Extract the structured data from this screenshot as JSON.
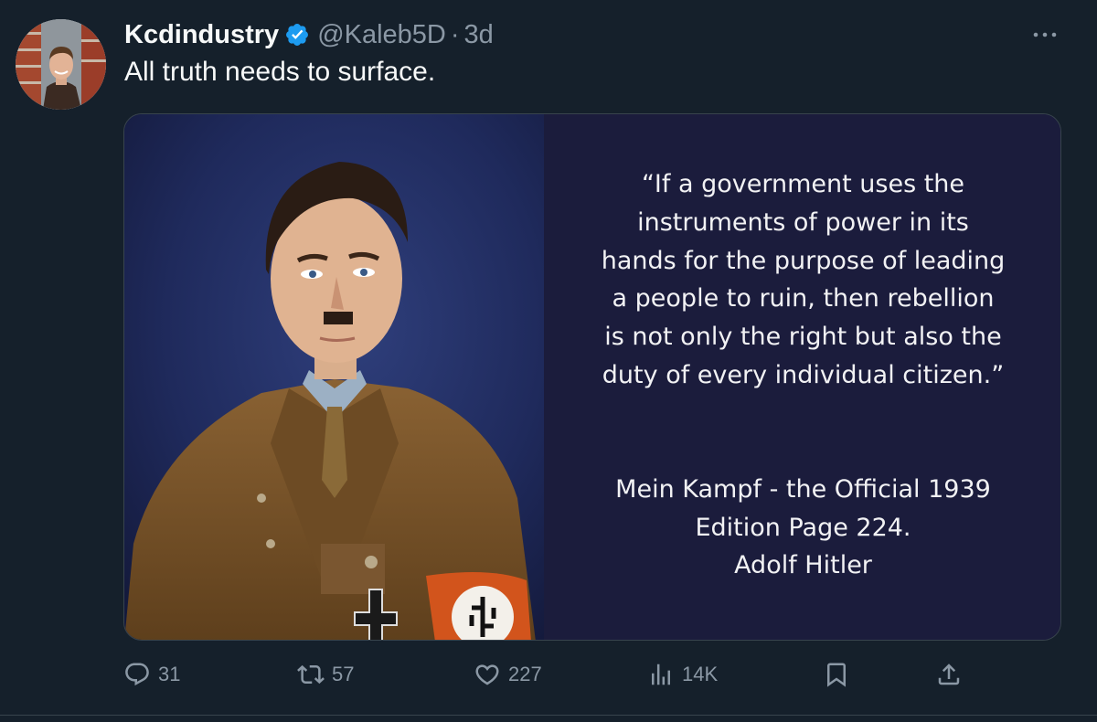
{
  "tweet": {
    "display_name": "Kcdindustry",
    "handle": "@Kaleb5D",
    "separator": "·",
    "age": "3d",
    "text": "All truth needs to surface.",
    "verified_color": "#1d9bf0"
  },
  "media": {
    "quote_lines": [
      "“If a government uses the",
      "instruments of power in its",
      "hands for the purpose of leading",
      "a people to ruin, then rebellion",
      "is not only the right but also the",
      "duty of every individual citizen.”"
    ],
    "attribution_lines": [
      "Mein Kampf - the Official 1939",
      "Edition Page 224.",
      "Adolf Hitler"
    ]
  },
  "actions": {
    "replies": "31",
    "reposts": "57",
    "likes": "227",
    "views": "14K"
  },
  "icons": {
    "more": "more-horizontal-icon",
    "verified": "verified-badge-icon",
    "reply": "reply-icon",
    "repost": "repost-icon",
    "like": "heart-icon",
    "views": "views-icon",
    "bookmark": "bookmark-icon",
    "share": "share-icon"
  },
  "colors": {
    "background": "#15202b",
    "muted_text": "#8b98a5",
    "quote_panel": "#1b1c3c"
  }
}
